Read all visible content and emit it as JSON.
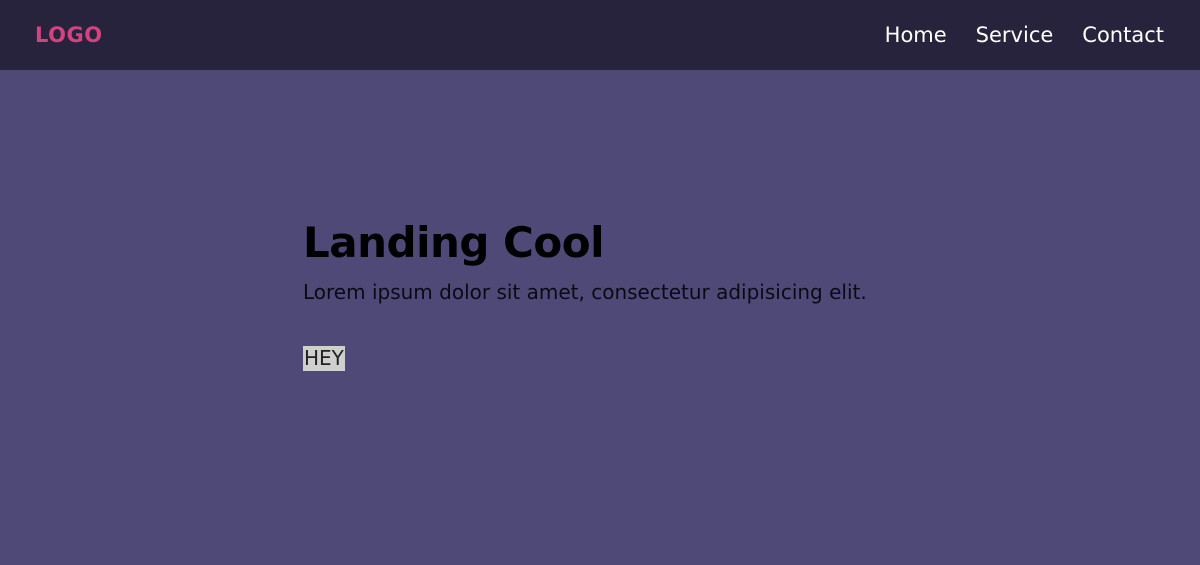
{
  "header": {
    "logo": "LOGO",
    "nav": [
      {
        "label": "Home"
      },
      {
        "label": "Service"
      },
      {
        "label": "Contact"
      }
    ]
  },
  "hero": {
    "title": "Landing Cool",
    "text": "Lorem ipsum dolor sit amet, consectetur adipisicing elit.",
    "button_label": "HEY"
  },
  "colors": {
    "navbar_bg": "#27233d",
    "page_bg": "#4f4977",
    "logo": "#d2437f",
    "nav_text": "#ffffff",
    "button_bg": "#cfcfcf"
  }
}
